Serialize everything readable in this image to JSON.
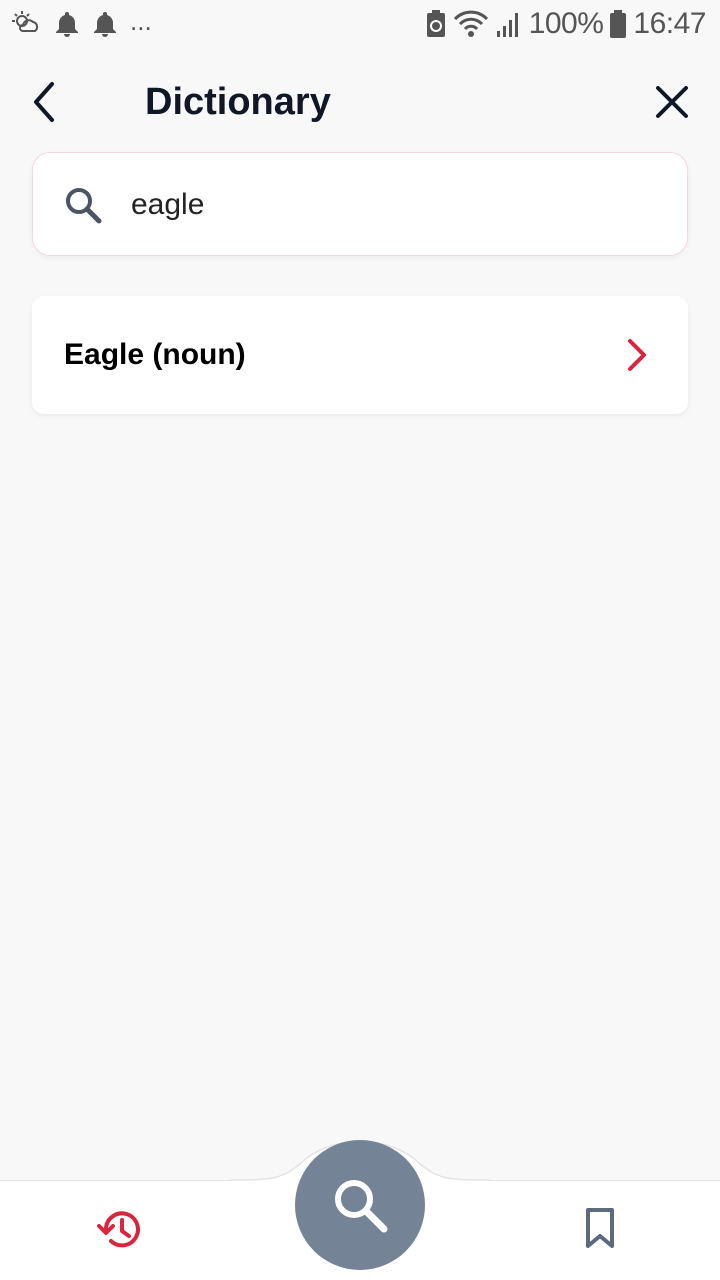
{
  "status_bar": {
    "battery": "100%",
    "time": "16:47",
    "left_icons": [
      "weather-icon",
      "bell-icon",
      "bell-icon"
    ],
    "overflow": "..."
  },
  "header": {
    "title": "Dictionary",
    "back_icon": "chevron-left-icon",
    "close_icon": "close-icon"
  },
  "search": {
    "value": "eagle",
    "icon": "search-icon"
  },
  "results": [
    {
      "label": "Eagle (noun)",
      "icon": "chevron-right-icon"
    }
  ],
  "bottom_nav": {
    "items": [
      {
        "name": "history",
        "icon": "history-icon",
        "active": true
      },
      {
        "name": "search",
        "icon": "search-icon"
      },
      {
        "name": "bookmarks",
        "icon": "bookmark-icon"
      }
    ]
  },
  "colors": {
    "accent": "#d7263d",
    "fab": "#748395",
    "background": "#f8f8f8",
    "title": "#101828"
  }
}
